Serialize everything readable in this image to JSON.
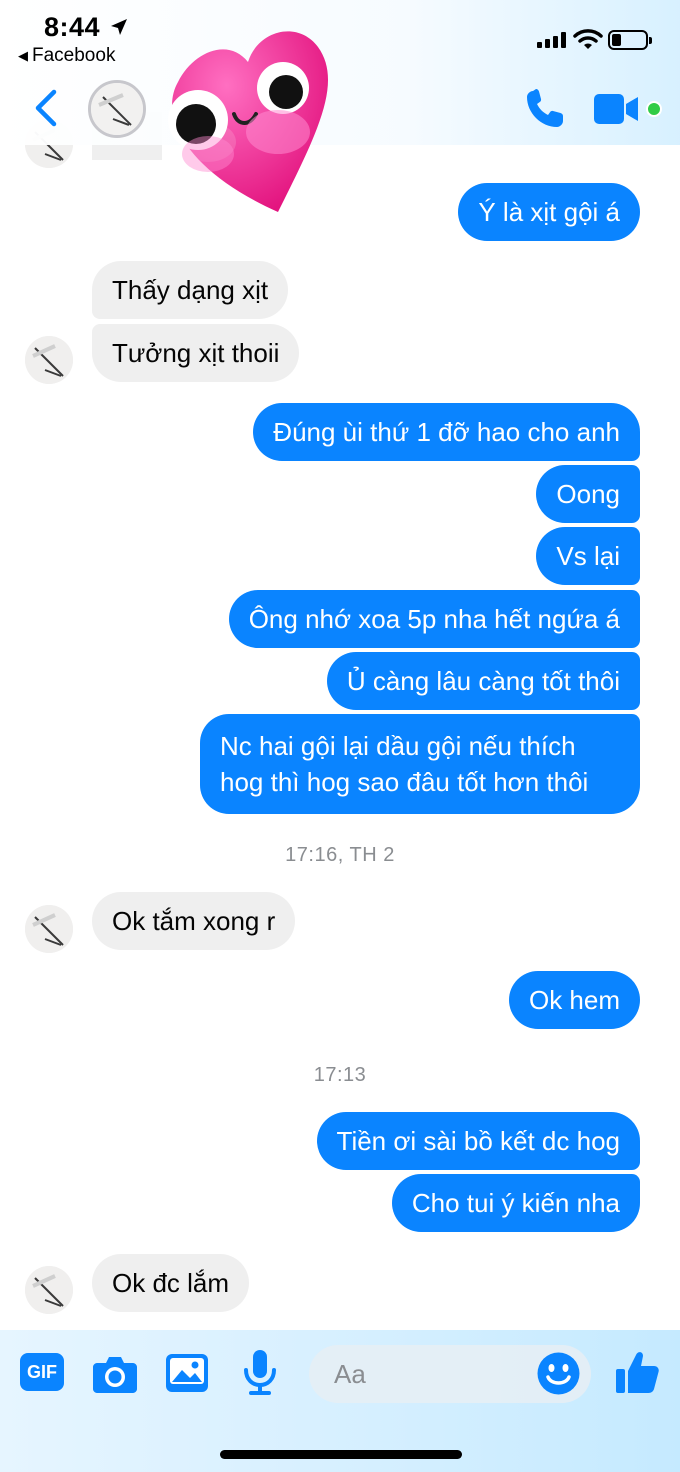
{
  "status_bar": {
    "time": "8:44",
    "back_app": "Facebook"
  },
  "header": {
    "sticker": "heart-face-sticker"
  },
  "messages": [
    {
      "direction": "out",
      "text": "Ý là xịt gội á"
    },
    {
      "direction": "in",
      "text": "Thấy dạng xịt"
    },
    {
      "direction": "in",
      "text": "Tưởng xịt thoii"
    },
    {
      "direction": "out",
      "text": "Đúng ùi thứ 1 đỡ hao cho anh"
    },
    {
      "direction": "out",
      "text": "Oong"
    },
    {
      "direction": "out",
      "text": "Vs lại"
    },
    {
      "direction": "out",
      "text": "Ông nhớ xoa 5p nha hết ngứa á"
    },
    {
      "direction": "out",
      "text": "Ủ càng lâu càng tốt thôi"
    },
    {
      "direction": "out",
      "text": "Nc hai gội lại dầu gội nếu thích hog thì hog sao đâu tốt hơn thôi"
    },
    {
      "type": "timestamp",
      "text": "17:16, TH 2"
    },
    {
      "direction": "in",
      "text": "Ok tắm xong r"
    },
    {
      "direction": "out",
      "text": "Ok hem"
    },
    {
      "type": "timestamp",
      "text": "17:13"
    },
    {
      "direction": "out",
      "text": "Tiền ơi sài bồ kết dc hog"
    },
    {
      "direction": "out",
      "text": "Cho tui ý kiến nha"
    },
    {
      "direction": "in",
      "text": "Ok đc lắm"
    }
  ],
  "composer": {
    "gif_label": "GIF",
    "placeholder": "Aa"
  },
  "colors": {
    "accent": "#0a84ff",
    "incoming_bubble": "#efefef",
    "online": "#31cc46"
  }
}
